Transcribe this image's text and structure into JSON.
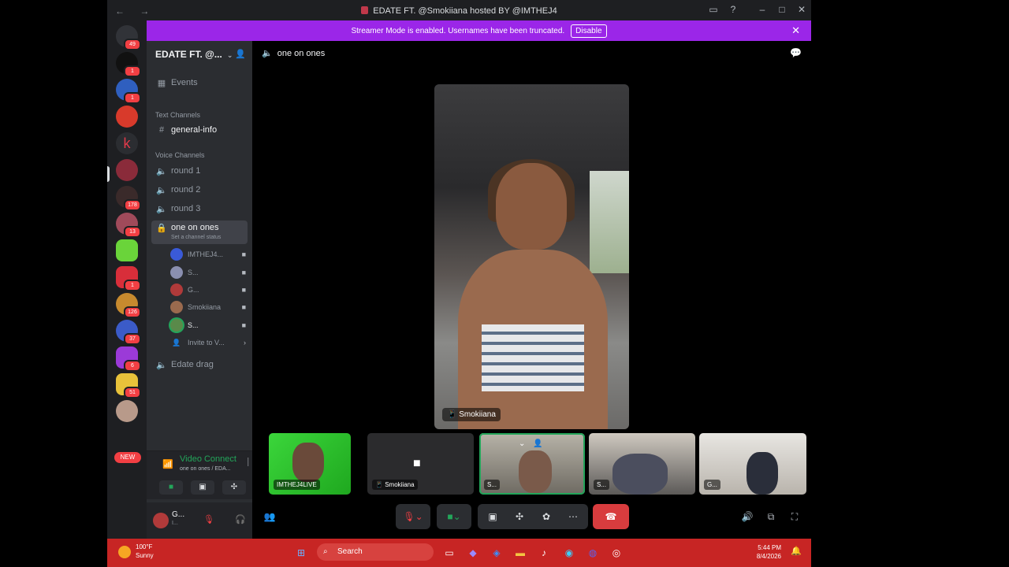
{
  "window": {
    "title": "EDATE FT. @Smokiiana hosted BY @IMTHEJ4",
    "nav_glyphs": "← →"
  },
  "banner": {
    "text": "Streamer Mode is enabled. Usernames have been truncated.",
    "button": "Disable"
  },
  "servers": [
    {
      "badge": "49"
    },
    {
      "badge": "1"
    },
    {
      "badge": "1"
    },
    {
      "badge": ""
    },
    {
      "badge": ""
    },
    {
      "badge": ""
    },
    {
      "badge": "178"
    },
    {
      "badge": "13"
    },
    {
      "badge": ""
    },
    {
      "badge": "1"
    },
    {
      "badge": "126"
    },
    {
      "badge": "37"
    },
    {
      "badge": "6"
    },
    {
      "badge": "51"
    },
    {
      "badge": ""
    }
  ],
  "new_badge": "NEW",
  "sidebar": {
    "guild_name": "EDATE FT. @...",
    "events": "Events",
    "text_category": "Text Channels",
    "text_channels": [
      "general-info"
    ],
    "voice_category": "Voice Channels",
    "voice_channels": [
      "round 1",
      "round 2",
      "round 3"
    ],
    "active_channel": "one on ones",
    "channel_status": "Set a channel status",
    "voice_users": [
      "IMTHEJ4...",
      "S...",
      "G...",
      "Smokiiana",
      "S..."
    ],
    "invite": "Invite to V...",
    "last_channel": "Edate drag"
  },
  "voice_panel": {
    "status": "Video Connect",
    "location": "one on ones / EDA..."
  },
  "user_panel": {
    "name": "G...",
    "status": "I..."
  },
  "main": {
    "channel": "one on ones",
    "stage_name": "Smokiiana",
    "tiles": [
      {
        "name": "IMTHEJ4LIVE"
      },
      {
        "name": "Smokiiana"
      },
      {
        "name": "S..."
      },
      {
        "name": "S..."
      },
      {
        "name": "G..."
      }
    ]
  },
  "taskbar": {
    "temp": "100°F",
    "weather": "Sunny",
    "search": "Search",
    "time": "5:44 PM",
    "date": "8/4/2026"
  },
  "colors": {
    "banner": "#9b26e8",
    "disconnect": "#d83c3e",
    "taskbar": "#c72524",
    "connected": "#23a55a"
  }
}
